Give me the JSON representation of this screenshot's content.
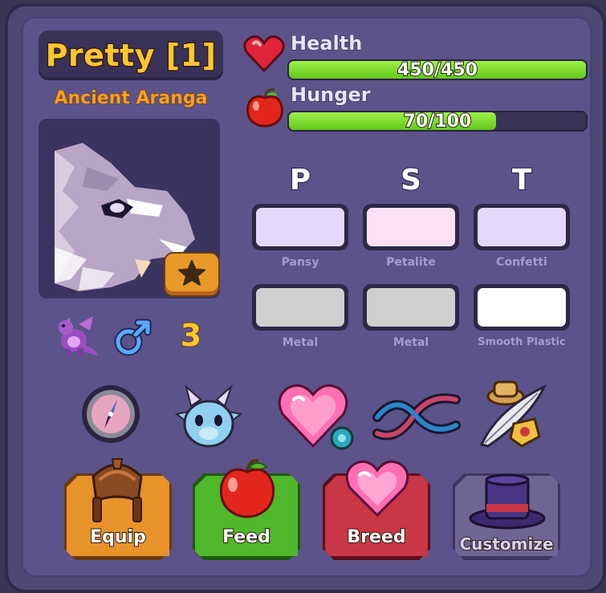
{
  "pet": {
    "name": "Pretty [1]",
    "species": "Ancient Aranga",
    "age": "3",
    "gender_icon": "male-symbol-icon",
    "type_icon": "dragon-icon"
  },
  "stats": {
    "health": {
      "label": "Health",
      "text": "450/450",
      "current": 450,
      "max": 450
    },
    "hunger": {
      "label": "Hunger",
      "text": "70/100",
      "current": 70,
      "max": 100
    }
  },
  "colors": {
    "headers": [
      "P",
      "S",
      "T"
    ],
    "row1": [
      {
        "name": "Pansy",
        "hex": "#e3d7fb"
      },
      {
        "name": "Petalite",
        "hex": "#fbe0f6"
      },
      {
        "name": "Confetti",
        "hex": "#e3d7fb"
      }
    ],
    "row2": [
      {
        "name": "Metal",
        "hex": "#cfcfcf"
      },
      {
        "name": "Metal",
        "hex": "#cfcfcf"
      },
      {
        "name": "Smooth Plastic",
        "hex": "#ffffff"
      }
    ]
  },
  "actions": {
    "icons": [
      "compass-icon",
      "creature-face-icon",
      "gem-heart-icon",
      "dna-icon",
      "quill-hat-icon"
    ]
  },
  "buttons": {
    "equip": {
      "label": "Equip",
      "color": "#e8922a"
    },
    "feed": {
      "label": "Feed",
      "color": "#4fb82b"
    },
    "breed": {
      "label": "Breed",
      "color": "#c93646"
    },
    "customize": {
      "label": "Customize",
      "color": "#6e6594"
    }
  },
  "theme": {
    "panel": "#5c538a",
    "accent_gold": "#ffc531",
    "bar_green": "#7edb2e"
  }
}
